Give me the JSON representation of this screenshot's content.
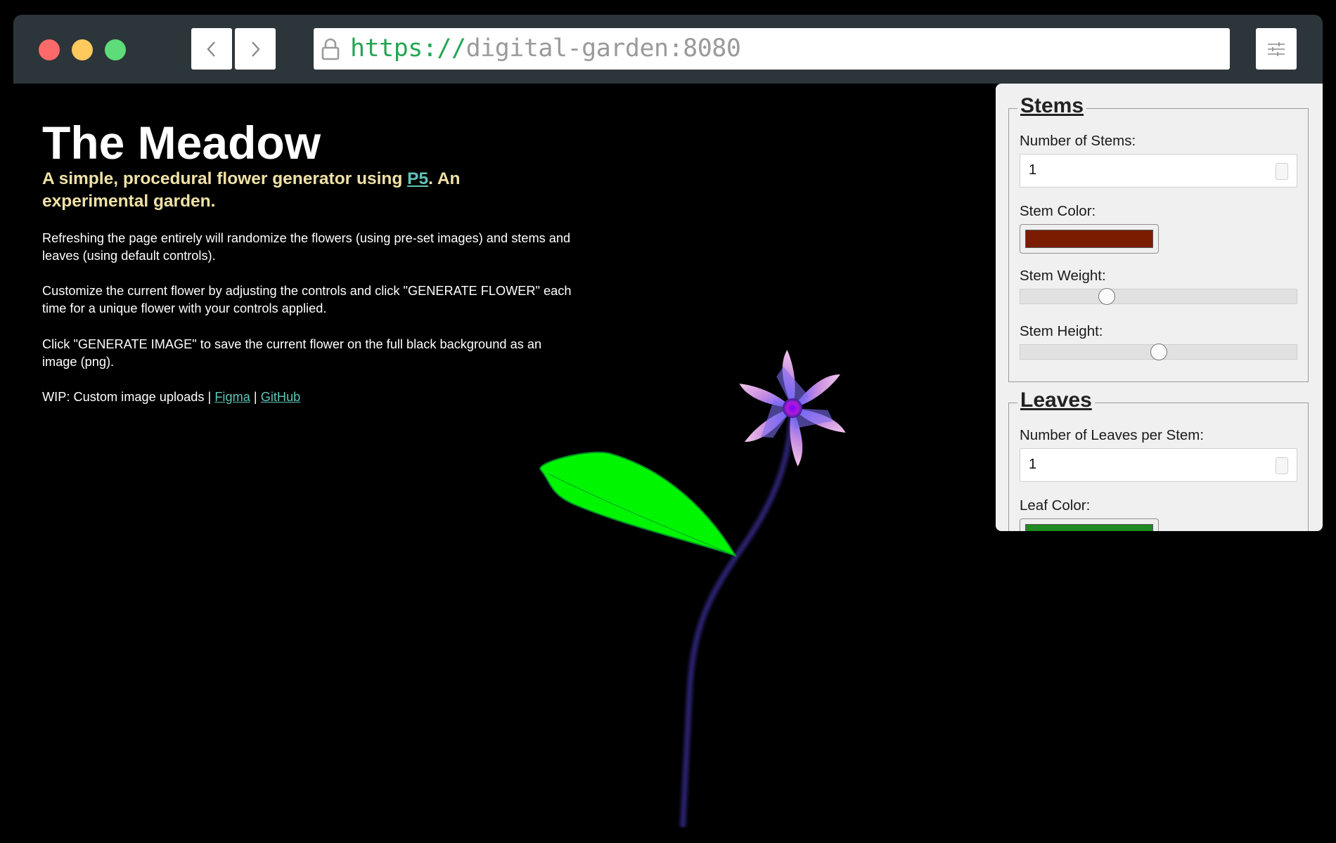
{
  "browser": {
    "url_scheme": "https://",
    "url_host": "digital-garden:8080"
  },
  "page": {
    "title": "The Meadow",
    "subtitle_before": "A simple, procedural flower generator using ",
    "subtitle_link": "P5",
    "subtitle_after": ". An experimental garden.",
    "paragraph_1": "Refreshing the page entirely will randomize the flowers (using pre-set images) and stems and leaves (using default controls).",
    "paragraph_2": "Customize the current flower by adjusting the controls and click \"GENERATE FLOWER\" each time for a unique flower with your controls applied.",
    "paragraph_3": "Click \"GENERATE IMAGE\" to save the current flower on the full black background as an image (png).",
    "wip_text": "WIP: Custom image uploads | ",
    "figma_link": "Figma",
    "separator": " | ",
    "github_link": "GitHub"
  },
  "controls": {
    "stems": {
      "legend": "Stems",
      "count_label": "Number of Stems:",
      "count_value": "1",
      "color_label": "Stem Color:",
      "color_value": "#7a1c00",
      "weight_label": "Stem Weight:",
      "weight_level": 0.3,
      "height_label": "Stem Height:",
      "height_level": 0.5
    },
    "leaves": {
      "legend": "Leaves",
      "count_label": "Number of Leaves per Stem:",
      "count_value": "1",
      "color_label": "Leaf Color:",
      "color_value": "#1f8a1f"
    }
  },
  "colors": {
    "titlebar": "#2c3539",
    "subtitle": "#f0e2a6",
    "link": "#5ec4b8",
    "leaf": "#00f500",
    "stem": "#2c2470"
  },
  "icons": {
    "back": "chevron-left-icon",
    "forward": "chevron-right-icon",
    "lock": "lock-icon",
    "menu": "sliders-icon"
  }
}
